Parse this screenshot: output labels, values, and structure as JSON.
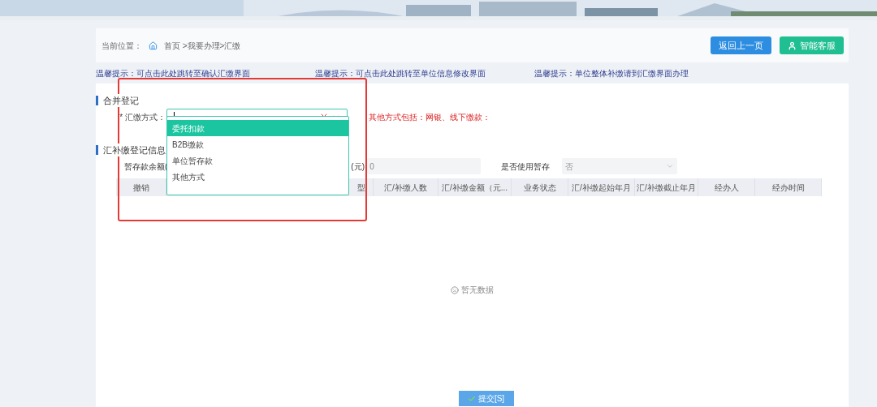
{
  "breadcrumb": {
    "label": "当前位置：",
    "path": "首页 >我要办理>汇缴"
  },
  "header_buttons": [
    {
      "label": "返回上一页",
      "kind": "back"
    },
    {
      "label": "智能客服",
      "kind": "service"
    }
  ],
  "tips": [
    "温馨提示：可点击此处跳转至确认汇缴界面",
    "温馨提示：可点击此处跳转至单位信息修改界面",
    "温馨提示：单位整体补缴请到汇缴界面办理"
  ],
  "merge_section": {
    "title": "合并登记",
    "field": {
      "label": "* 汇缴方式："
    },
    "note": "其他方式包括：网银、线下缴款："
  },
  "dropdown": {
    "options": [
      {
        "label": "委托扣款",
        "selected": true
      },
      {
        "label": "B2B缴款",
        "selected": false
      },
      {
        "label": "单位暂存款",
        "selected": false
      },
      {
        "label": "其他方式",
        "selected": false
      }
    ]
  },
  "register_section": {
    "title": "汇补缴登记信息",
    "balance_label": "暂存款余额(",
    "amount_label": "(元)",
    "amount_value": "0",
    "use_label": "是否使用暂存",
    "use_value": "否"
  },
  "table": {
    "columns": [
      "撤销",
      "",
      "型",
      "汇/补缴人数",
      "汇/补缴金额（元...",
      "业务状态",
      "汇/补缴起始年月",
      "汇/补缴截止年月",
      "经办人",
      "经办时间"
    ],
    "empty_text": "暂无数据"
  },
  "submit_button": "提交[S]"
}
